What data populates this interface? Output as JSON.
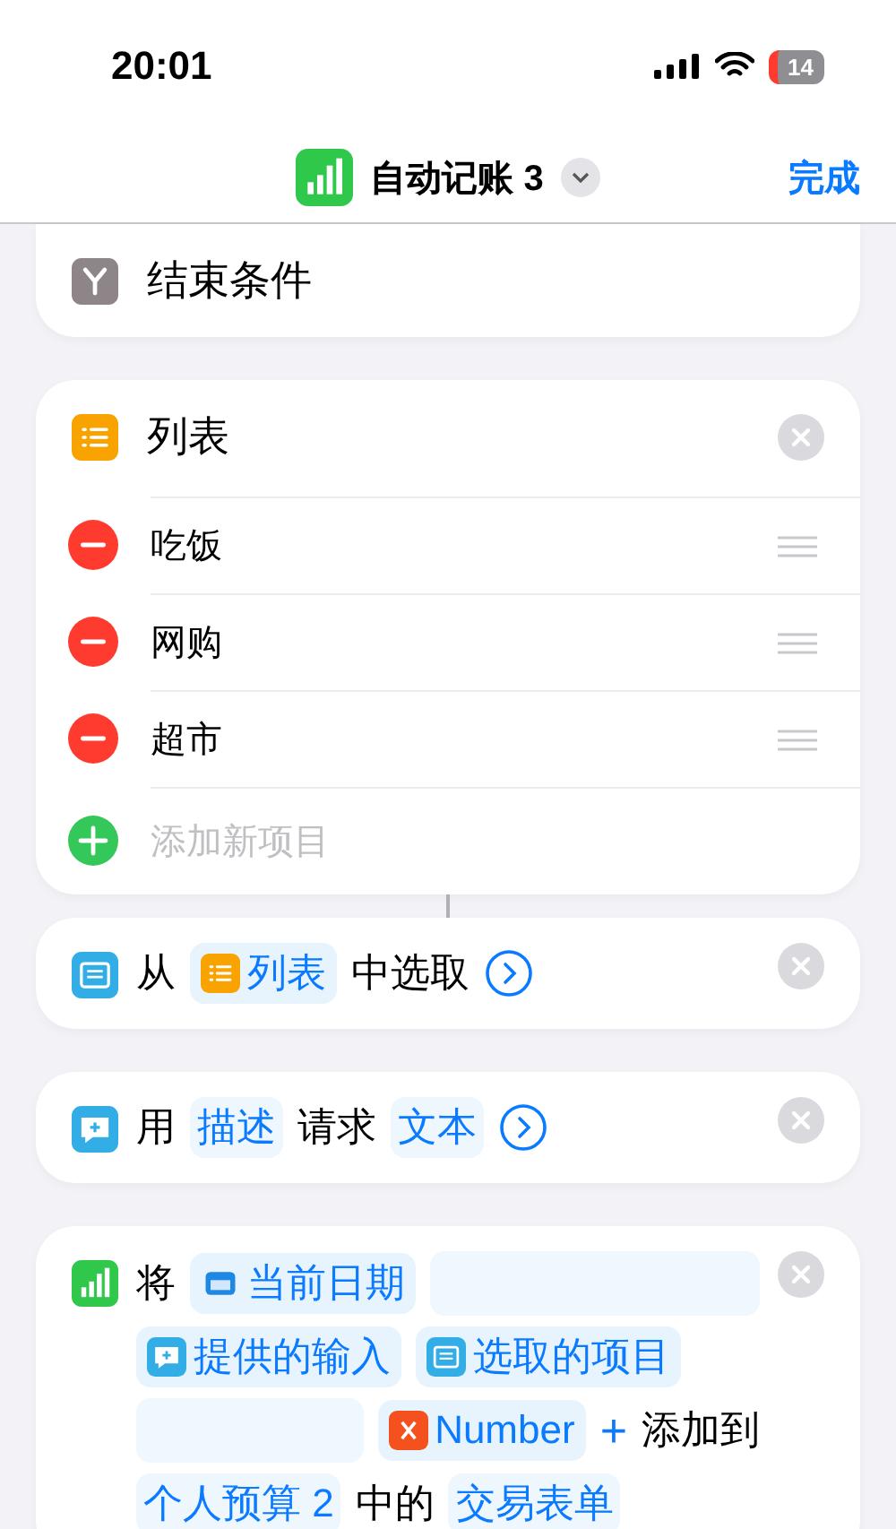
{
  "status_bar": {
    "time": "20:01",
    "battery": "14"
  },
  "nav": {
    "title": "自动记账 3",
    "done": "完成"
  },
  "actions": [
    {
      "kind": "end_condition",
      "title": "结束条件",
      "removable": false,
      "connector": false
    },
    {
      "kind": "list",
      "title": "列表",
      "removable": true,
      "connector": true,
      "items": [
        {
          "text": "吃饭"
        },
        {
          "text": "网购"
        },
        {
          "text": "超市"
        }
      ],
      "add_placeholder": "添加新项目"
    },
    {
      "kind": "choose_from_list",
      "removable": true,
      "connector": false,
      "tokens": [
        {
          "kind": "text",
          "text": "从"
        },
        {
          "kind": "list_variable",
          "text": "列表"
        },
        {
          "kind": "text",
          "text": "中选取"
        },
        {
          "kind": "expand"
        }
      ]
    },
    {
      "kind": "ask_for_input",
      "removable": true,
      "connector": false,
      "tokens": [
        {
          "kind": "text",
          "text": "用"
        },
        {
          "kind": "param",
          "text": "描述"
        },
        {
          "kind": "text",
          "text": "请求"
        },
        {
          "kind": "param",
          "text": "文本"
        },
        {
          "kind": "expand"
        }
      ]
    },
    {
      "kind": "add_row",
      "removable": true,
      "connector": false,
      "tokens": [
        {
          "kind": "text",
          "text": "将"
        },
        {
          "kind": "date_variable",
          "text": "当前日期"
        },
        {
          "kind": "blank"
        },
        {
          "kind": "input_variable",
          "text": "提供的输入"
        },
        {
          "kind": "choice_variable",
          "text": "选取的项目"
        },
        {
          "kind": "blank"
        },
        {
          "kind": "number_variable",
          "text": "Number"
        },
        {
          "kind": "operator",
          "text": "+"
        },
        {
          "kind": "text",
          "text": "添加到"
        },
        {
          "kind": "param",
          "text": "个人预算 2"
        },
        {
          "kind": "text",
          "text": "中的"
        },
        {
          "kind": "param",
          "text": "交易表单"
        }
      ]
    }
  ]
}
